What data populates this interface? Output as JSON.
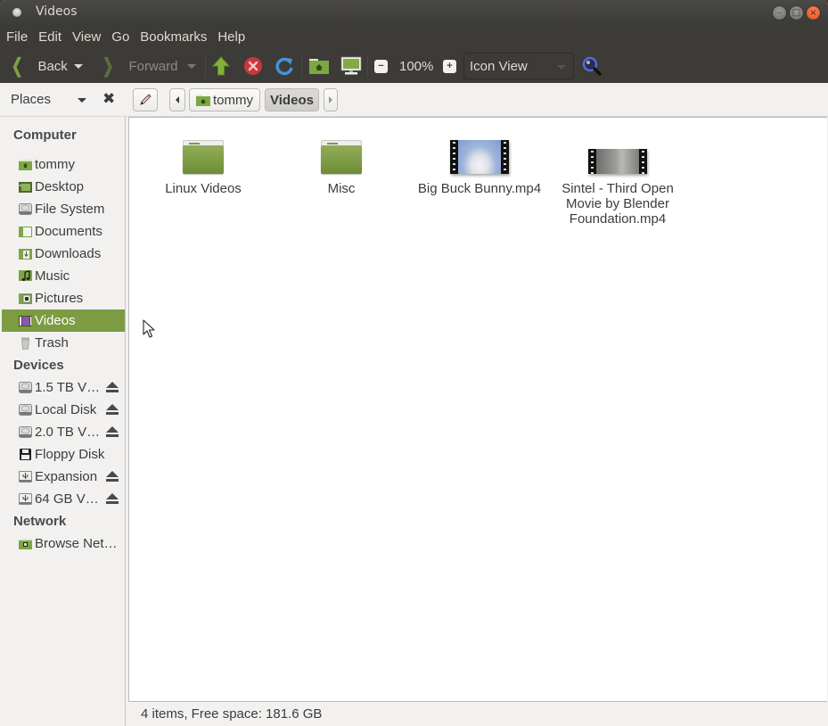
{
  "window": {
    "title": "Videos",
    "buttons": {
      "minimize": "–",
      "maximize": "□",
      "close": "×"
    }
  },
  "menubar": {
    "items": [
      "File",
      "Edit",
      "View",
      "Go",
      "Bookmarks",
      "Help"
    ]
  },
  "toolbar": {
    "back_label": "Back",
    "forward_label": "Forward",
    "zoom_level": "100%",
    "zoom_out_glyph": "−",
    "zoom_in_glyph": "+",
    "view_mode": "Icon View",
    "icons": [
      "back-icon",
      "forward-icon",
      "up-icon",
      "stop-icon",
      "reload-icon",
      "home-icon",
      "computer-icon",
      "zoom-out-icon",
      "zoom-in-icon",
      "search-icon"
    ]
  },
  "locationbar": {
    "sidebar_selector": "Places",
    "close_glyph": "✖",
    "breadcrumbs": [
      "tommy",
      "Videos"
    ],
    "active_crumb": "Videos"
  },
  "sidebar": {
    "sections": [
      {
        "heading": "Computer",
        "items": [
          {
            "label": "tommy",
            "icon": "home-folder-icon"
          },
          {
            "label": "Desktop",
            "icon": "desktop-folder-icon"
          },
          {
            "label": "File System",
            "icon": "harddisk-icon"
          },
          {
            "label": "Documents",
            "icon": "documents-folder-icon"
          },
          {
            "label": "Downloads",
            "icon": "downloads-folder-icon"
          },
          {
            "label": "Music",
            "icon": "music-folder-icon"
          },
          {
            "label": "Pictures",
            "icon": "pictures-folder-icon"
          },
          {
            "label": "Videos",
            "icon": "videos-folder-icon",
            "selected": true
          },
          {
            "label": "Trash",
            "icon": "trash-icon"
          }
        ]
      },
      {
        "heading": "Devices",
        "items": [
          {
            "label": "1.5 TB V…",
            "icon": "harddisk-icon",
            "eject": true
          },
          {
            "label": "Local Disk",
            "icon": "harddisk-icon",
            "eject": true
          },
          {
            "label": "2.0 TB V…",
            "icon": "harddisk-icon",
            "eject": true
          },
          {
            "label": "Floppy Disk",
            "icon": "floppy-icon",
            "eject": false
          },
          {
            "label": "Expansion",
            "icon": "usb-drive-icon",
            "eject": true
          },
          {
            "label": "64 GB V…",
            "icon": "usb-drive-icon",
            "eject": true
          }
        ]
      },
      {
        "heading": "Network",
        "items": [
          {
            "label": "Browse Net…",
            "icon": "network-icon"
          }
        ]
      }
    ]
  },
  "content": {
    "files": [
      {
        "name": "Linux Videos",
        "type": "folder"
      },
      {
        "name": "Misc",
        "type": "folder"
      },
      {
        "name": "Big Buck Bunny.mp4",
        "type": "video"
      },
      {
        "name": "Sintel - Third Open Movie by Blender Foundation.mp4",
        "type": "video"
      }
    ]
  },
  "statusbar": {
    "text": "4 items, Free space: 181.6 GB"
  },
  "colors": {
    "accent": "#7c9b43",
    "titlebar": "#3c3b37",
    "close_button": "#e0481a"
  }
}
